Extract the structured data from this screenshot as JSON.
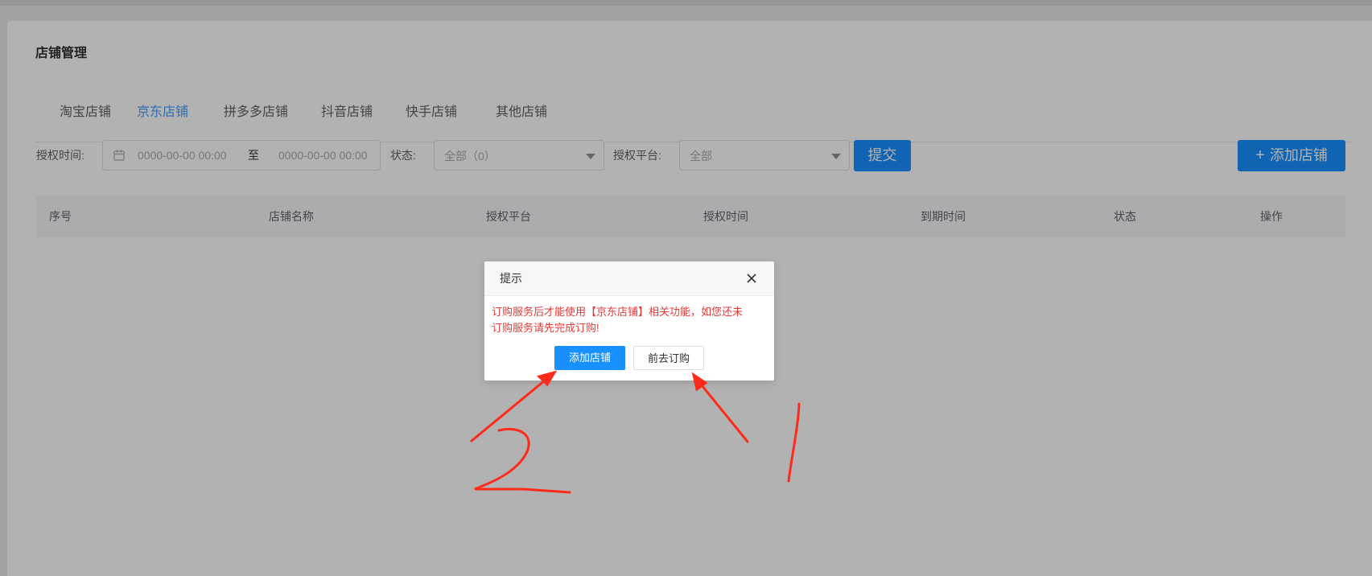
{
  "page": {
    "title": "店铺管理"
  },
  "tabs": [
    {
      "label": "淘宝店铺",
      "active": false
    },
    {
      "label": "京东店铺",
      "active": true
    },
    {
      "label": "拼多多店铺",
      "active": false
    },
    {
      "label": "抖音店铺",
      "active": false
    },
    {
      "label": "快手店铺",
      "active": false
    },
    {
      "label": "其他店铺",
      "active": false
    }
  ],
  "filters": {
    "auth_time_label": "授权时间:",
    "start_placeholder": "0000-00-00 00:00",
    "range_separator": "至",
    "end_placeholder": "0000-00-00 00:00",
    "status_label": "状态:",
    "status_value": "全部（0）",
    "platform_label": "授权平台:",
    "platform_value": "全部",
    "submit_label": "提交",
    "add_shop_label": "添加店铺",
    "add_shop_icon": "plus-icon"
  },
  "table": {
    "columns": [
      "序号",
      "店铺名称",
      "授权平台",
      "授权时间",
      "到期时间",
      "状态",
      "操作"
    ],
    "rows": []
  },
  "dialog": {
    "title": "提示",
    "close_icon": "close-icon",
    "message_line1": "订购服务后才能使用【京东店铺】相关功能，如您还未",
    "message_line2": "订购服务请先完成订购!",
    "primary_label": "添加店铺",
    "secondary_label": "前去订购"
  },
  "annotations": {
    "label_left": "2",
    "label_right": "1",
    "color": "#ff2a1a"
  },
  "colors": {
    "primary": "#1890ff",
    "tab_active": "#409eff",
    "warning_text": "#e53935"
  }
}
